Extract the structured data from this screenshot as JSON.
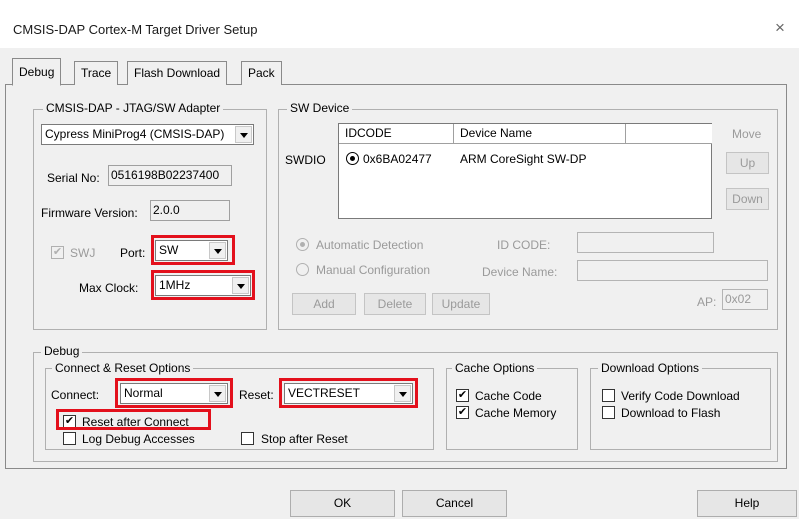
{
  "window": {
    "title": "CMSIS-DAP Cortex-M Target Driver Setup",
    "close_glyph": "×"
  },
  "tabs": [
    {
      "label": "Debug",
      "active": true
    },
    {
      "label": "Trace"
    },
    {
      "label": "Flash Download"
    },
    {
      "label": "Pack"
    }
  ],
  "adapter": {
    "title": "CMSIS-DAP - JTAG/SW Adapter",
    "device": "Cypress MiniProg4 (CMSIS-DAP)",
    "serial_label": "Serial No:",
    "serial_value": "0516198B02237400",
    "fw_label": "Firmware Version:",
    "fw_value": "2.0.0",
    "swj_label": "SWJ",
    "port_label": "Port:",
    "port_value": "SW",
    "clock_label": "Max Clock:",
    "clock_value": "1MHz"
  },
  "sw_device": {
    "title": "SW Device",
    "swdio_label": "SWDIO",
    "col_idcode": "IDCODE",
    "col_name": "Device Name",
    "row_idcode": "0x6BA02477",
    "row_name": "ARM CoreSight SW-DP",
    "move_label": "Move",
    "up_label": "Up",
    "down_label": "Down",
    "auto_label": "Automatic Detection",
    "manual_label": "Manual Configuration",
    "id_code_label": "ID CODE:",
    "device_name_label": "Device Name:",
    "add_label": "Add",
    "delete_label": "Delete",
    "update_label": "Update",
    "ap_label": "AP:",
    "ap_value": "0x02"
  },
  "debug": {
    "title": "Debug",
    "connect_reset_title": "Connect & Reset Options",
    "connect_label": "Connect:",
    "connect_value": "Normal",
    "reset_label": "Reset:",
    "reset_value": "VECTRESET",
    "reset_after_connect": "Reset after Connect",
    "log_debug": "Log Debug Accesses",
    "stop_after_reset": "Stop after Reset",
    "cache_title": "Cache Options",
    "cache_code": "Cache Code",
    "cache_memory": "Cache Memory",
    "download_title": "Download Options",
    "verify_code": "Verify Code Download",
    "download_flash": "Download to Flash"
  },
  "buttons": {
    "ok": "OK",
    "cancel": "Cancel",
    "help": "Help"
  },
  "check_glyph": "✔",
  "colors": {
    "highlight": "#e3101c",
    "panel": "#f0f0f0"
  }
}
